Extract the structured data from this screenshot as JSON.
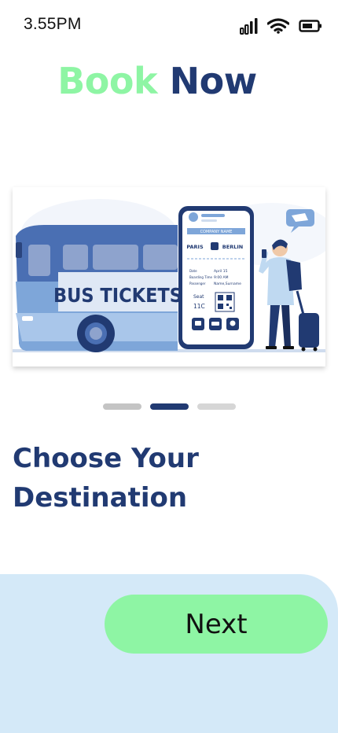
{
  "status_bar": {
    "time": "3.55PM"
  },
  "header": {
    "title_part1": "Book",
    "title_part2": "Now"
  },
  "illustration": {
    "bus_label": "BUS TICKETS",
    "ticket": {
      "company": "COMPANY NAME",
      "from": "PARIS",
      "to": "BERLIN",
      "date_label": "Date",
      "date_value": "April 15",
      "boarding_label": "Boarding Time",
      "boarding_value": "9:00 AM",
      "passenger_label": "Passenger",
      "passenger_value": "Name,Surname",
      "seat_label": "Seat",
      "seat_value": "11C"
    }
  },
  "pagination": {
    "count": 3,
    "active_index": 1
  },
  "headline": {
    "line1": "Choose Your",
    "line2": "Destination"
  },
  "footer": {
    "next_label": "Next"
  },
  "colors": {
    "accent_green": "#8ef5a4",
    "navy": "#213a72",
    "panel_blue": "#d4e9f8"
  }
}
